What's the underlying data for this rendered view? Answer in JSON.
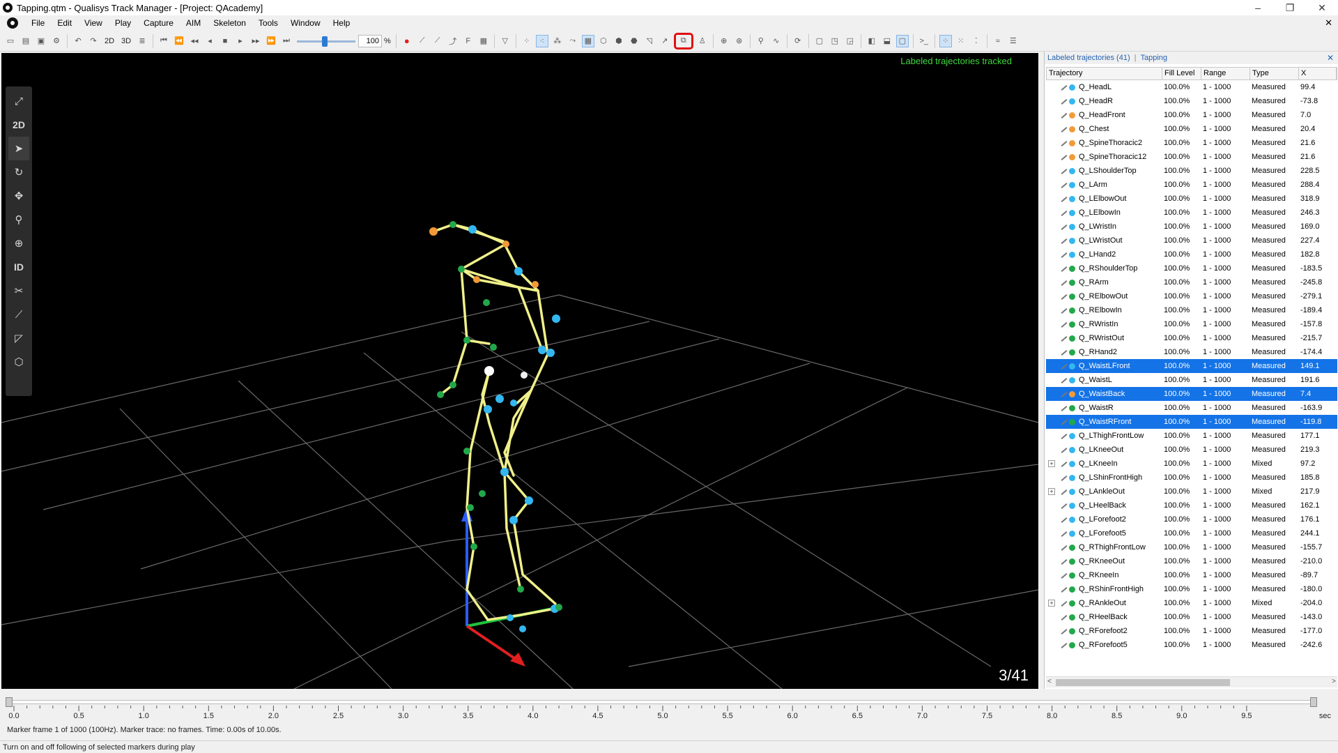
{
  "window": {
    "title": "Tapping.qtm - Qualisys Track Manager - [Project: QAcademy]",
    "minimize": "–",
    "maximize": "❐",
    "close": "✕"
  },
  "menu": {
    "items": [
      "File",
      "Edit",
      "View",
      "Play",
      "Capture",
      "AIM",
      "Skeleton",
      "Tools",
      "Window",
      "Help"
    ],
    "close_doc": "✕"
  },
  "toolbar": {
    "view_2d": "2D",
    "view_3d": "3D",
    "speed_value": "100",
    "speed_unit": "%"
  },
  "viewport": {
    "status": "Labeled trajectories tracked",
    "frame_counter": "3/41"
  },
  "leftpanel": {
    "btn_2d": "2D",
    "btn_id": "ID"
  },
  "trajpanel": {
    "title": "Labeled trajectories (41)",
    "separator": "|",
    "subject": "Tapping",
    "close": "✕",
    "columns": [
      "Trajectory",
      "Fill Level",
      "Range",
      "Type",
      "X"
    ],
    "scroll_left": "<",
    "scroll_right": ">",
    "rows": [
      {
        "name": "Q_HeadL",
        "fill": "100.0%",
        "range": "1 - 1000",
        "type": "Measured",
        "x": "99.4",
        "color": "#34b7f0",
        "selected": false,
        "expand": false
      },
      {
        "name": "Q_HeadR",
        "fill": "100.0%",
        "range": "1 - 1000",
        "type": "Measured",
        "x": "-73.8",
        "color": "#34b7f0",
        "selected": false,
        "expand": false
      },
      {
        "name": "Q_HeadFront",
        "fill": "100.0%",
        "range": "1 - 1000",
        "type": "Measured",
        "x": "7.0",
        "color": "#f29a38",
        "selected": false,
        "expand": false
      },
      {
        "name": "Q_Chest",
        "fill": "100.0%",
        "range": "1 - 1000",
        "type": "Measured",
        "x": "20.4",
        "color": "#f29a38",
        "selected": false,
        "expand": false
      },
      {
        "name": "Q_SpineThoracic2",
        "fill": "100.0%",
        "range": "1 - 1000",
        "type": "Measured",
        "x": "21.6",
        "color": "#f29a38",
        "selected": false,
        "expand": false
      },
      {
        "name": "Q_SpineThoracic12",
        "fill": "100.0%",
        "range": "1 - 1000",
        "type": "Measured",
        "x": "21.6",
        "color": "#f29a38",
        "selected": false,
        "expand": false
      },
      {
        "name": "Q_LShoulderTop",
        "fill": "100.0%",
        "range": "1 - 1000",
        "type": "Measured",
        "x": "228.5",
        "color": "#34b7f0",
        "selected": false,
        "expand": false
      },
      {
        "name": "Q_LArm",
        "fill": "100.0%",
        "range": "1 - 1000",
        "type": "Measured",
        "x": "288.4",
        "color": "#34b7f0",
        "selected": false,
        "expand": false
      },
      {
        "name": "Q_LElbowOut",
        "fill": "100.0%",
        "range": "1 - 1000",
        "type": "Measured",
        "x": "318.9",
        "color": "#34b7f0",
        "selected": false,
        "expand": false
      },
      {
        "name": "Q_LElbowIn",
        "fill": "100.0%",
        "range": "1 - 1000",
        "type": "Measured",
        "x": "246.3",
        "color": "#34b7f0",
        "selected": false,
        "expand": false
      },
      {
        "name": "Q_LWristIn",
        "fill": "100.0%",
        "range": "1 - 1000",
        "type": "Measured",
        "x": "169.0",
        "color": "#34b7f0",
        "selected": false,
        "expand": false
      },
      {
        "name": "Q_LWristOut",
        "fill": "100.0%",
        "range": "1 - 1000",
        "type": "Measured",
        "x": "227.4",
        "color": "#34b7f0",
        "selected": false,
        "expand": false
      },
      {
        "name": "Q_LHand2",
        "fill": "100.0%",
        "range": "1 - 1000",
        "type": "Measured",
        "x": "182.8",
        "color": "#34b7f0",
        "selected": false,
        "expand": false
      },
      {
        "name": "Q_RShoulderTop",
        "fill": "100.0%",
        "range": "1 - 1000",
        "type": "Measured",
        "x": "-183.5",
        "color": "#22a84a",
        "selected": false,
        "expand": false
      },
      {
        "name": "Q_RArm",
        "fill": "100.0%",
        "range": "1 - 1000",
        "type": "Measured",
        "x": "-245.8",
        "color": "#22a84a",
        "selected": false,
        "expand": false
      },
      {
        "name": "Q_RElbowOut",
        "fill": "100.0%",
        "range": "1 - 1000",
        "type": "Measured",
        "x": "-279.1",
        "color": "#22a84a",
        "selected": false,
        "expand": false
      },
      {
        "name": "Q_RElbowIn",
        "fill": "100.0%",
        "range": "1 - 1000",
        "type": "Measured",
        "x": "-189.4",
        "color": "#22a84a",
        "selected": false,
        "expand": false
      },
      {
        "name": "Q_RWristIn",
        "fill": "100.0%",
        "range": "1 - 1000",
        "type": "Measured",
        "x": "-157.8",
        "color": "#22a84a",
        "selected": false,
        "expand": false
      },
      {
        "name": "Q_RWristOut",
        "fill": "100.0%",
        "range": "1 - 1000",
        "type": "Measured",
        "x": "-215.7",
        "color": "#22a84a",
        "selected": false,
        "expand": false
      },
      {
        "name": "Q_RHand2",
        "fill": "100.0%",
        "range": "1 - 1000",
        "type": "Measured",
        "x": "-174.4",
        "color": "#22a84a",
        "selected": false,
        "expand": false
      },
      {
        "name": "Q_WaistLFront",
        "fill": "100.0%",
        "range": "1 - 1000",
        "type": "Measured",
        "x": "149.1",
        "color": "#34b7f0",
        "selected": true,
        "expand": false
      },
      {
        "name": "Q_WaistL",
        "fill": "100.0%",
        "range": "1 - 1000",
        "type": "Measured",
        "x": "191.6",
        "color": "#34b7f0",
        "selected": false,
        "expand": false
      },
      {
        "name": "Q_WaistBack",
        "fill": "100.0%",
        "range": "1 - 1000",
        "type": "Measured",
        "x": "7.4",
        "color": "#f29a38",
        "selected": true,
        "expand": false
      },
      {
        "name": "Q_WaistR",
        "fill": "100.0%",
        "range": "1 - 1000",
        "type": "Measured",
        "x": "-163.9",
        "color": "#22a84a",
        "selected": false,
        "expand": false
      },
      {
        "name": "Q_WaistRFront",
        "fill": "100.0%",
        "range": "1 - 1000",
        "type": "Measured",
        "x": "-119.8",
        "color": "#22a84a",
        "selected": true,
        "expand": false
      },
      {
        "name": "Q_LThighFrontLow",
        "fill": "100.0%",
        "range": "1 - 1000",
        "type": "Measured",
        "x": "177.1",
        "color": "#34b7f0",
        "selected": false,
        "expand": false
      },
      {
        "name": "Q_LKneeOut",
        "fill": "100.0%",
        "range": "1 - 1000",
        "type": "Measured",
        "x": "219.3",
        "color": "#34b7f0",
        "selected": false,
        "expand": false
      },
      {
        "name": "Q_LKneeIn",
        "fill": "100.0%",
        "range": "1 - 1000",
        "type": "Mixed",
        "x": "97.2",
        "color": "#34b7f0",
        "selected": false,
        "expand": true
      },
      {
        "name": "Q_LShinFrontHigh",
        "fill": "100.0%",
        "range": "1 - 1000",
        "type": "Measured",
        "x": "185.8",
        "color": "#34b7f0",
        "selected": false,
        "expand": false
      },
      {
        "name": "Q_LAnkleOut",
        "fill": "100.0%",
        "range": "1 - 1000",
        "type": "Mixed",
        "x": "217.9",
        "color": "#34b7f0",
        "selected": false,
        "expand": true
      },
      {
        "name": "Q_LHeelBack",
        "fill": "100.0%",
        "range": "1 - 1000",
        "type": "Measured",
        "x": "162.1",
        "color": "#34b7f0",
        "selected": false,
        "expand": false
      },
      {
        "name": "Q_LForefoot2",
        "fill": "100.0%",
        "range": "1 - 1000",
        "type": "Measured",
        "x": "176.1",
        "color": "#34b7f0",
        "selected": false,
        "expand": false
      },
      {
        "name": "Q_LForefoot5",
        "fill": "100.0%",
        "range": "1 - 1000",
        "type": "Measured",
        "x": "244.1",
        "color": "#34b7f0",
        "selected": false,
        "expand": false
      },
      {
        "name": "Q_RThighFrontLow",
        "fill": "100.0%",
        "range": "1 - 1000",
        "type": "Measured",
        "x": "-155.7",
        "color": "#22a84a",
        "selected": false,
        "expand": false
      },
      {
        "name": "Q_RKneeOut",
        "fill": "100.0%",
        "range": "1 - 1000",
        "type": "Measured",
        "x": "-210.0",
        "color": "#22a84a",
        "selected": false,
        "expand": false
      },
      {
        "name": "Q_RKneeIn",
        "fill": "100.0%",
        "range": "1 - 1000",
        "type": "Measured",
        "x": "-89.7",
        "color": "#22a84a",
        "selected": false,
        "expand": false
      },
      {
        "name": "Q_RShinFrontHigh",
        "fill": "100.0%",
        "range": "1 - 1000",
        "type": "Measured",
        "x": "-180.0",
        "color": "#22a84a",
        "selected": false,
        "expand": false
      },
      {
        "name": "Q_RAnkleOut",
        "fill": "100.0%",
        "range": "1 - 1000",
        "type": "Mixed",
        "x": "-204.0",
        "color": "#22a84a",
        "selected": false,
        "expand": true
      },
      {
        "name": "Q_RHeelBack",
        "fill": "100.0%",
        "range": "1 - 1000",
        "type": "Measured",
        "x": "-143.0",
        "color": "#22a84a",
        "selected": false,
        "expand": false
      },
      {
        "name": "Q_RForefoot2",
        "fill": "100.0%",
        "range": "1 - 1000",
        "type": "Measured",
        "x": "-177.0",
        "color": "#22a84a",
        "selected": false,
        "expand": false
      },
      {
        "name": "Q_RForefoot5",
        "fill": "100.0%",
        "range": "1 - 1000",
        "type": "Measured",
        "x": "-242.6",
        "color": "#22a84a",
        "selected": false,
        "expand": false
      }
    ]
  },
  "timeline": {
    "tick_labels": [
      "0.0",
      "0.5",
      "1.0",
      "1.5",
      "2.0",
      "2.5",
      "3.0",
      "3.5",
      "4.0",
      "4.5",
      "5.0",
      "5.5",
      "6.0",
      "6.5",
      "7.0",
      "7.5",
      "8.0",
      "8.5",
      "9.0",
      "9.5"
    ],
    "unit": "sec",
    "frame_info": "Marker frame 1 of 1000 (100Hz). Marker trace: no frames. Time: 0.00s of 10.00s."
  },
  "status": {
    "text": "Turn on and off following of selected markers during play"
  }
}
